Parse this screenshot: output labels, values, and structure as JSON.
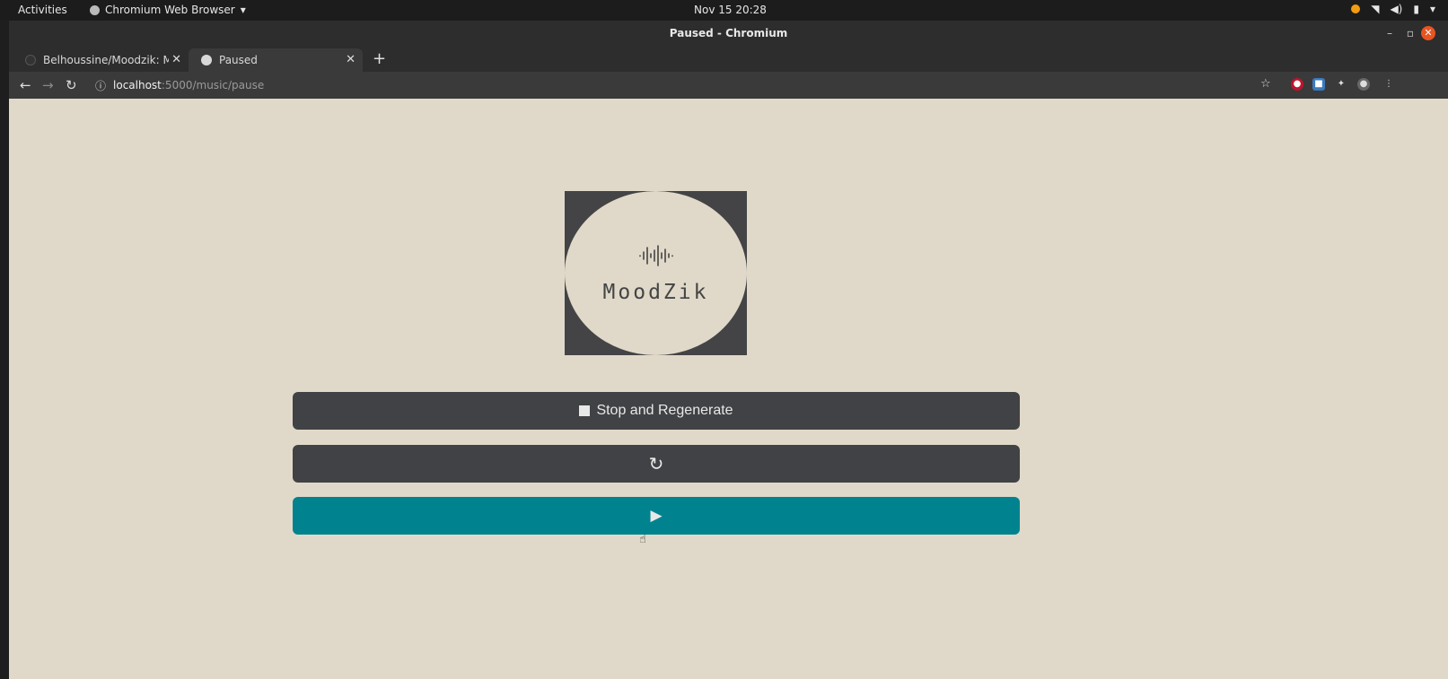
{
  "system_bar": {
    "activities": "Activities",
    "app_menu": "Chromium Web Browser",
    "clock": "Nov 15  20:28"
  },
  "window": {
    "title": "Paused - Chromium",
    "controls": {
      "minimize": "–",
      "maximize": "▫",
      "close": "✕"
    }
  },
  "tabs": [
    {
      "label": "Belhoussine/Moodzik: M",
      "active": false
    },
    {
      "label": "Paused",
      "active": true
    }
  ],
  "new_tab": "+",
  "address_bar": {
    "host": "localhost",
    "path": ":5000/music/pause"
  },
  "page": {
    "logo_text": "MoodZik",
    "stop_label": "Stop and Regenerate",
    "regenerate_icon": "↻",
    "play_icon": "▶"
  },
  "colors": {
    "page_bg": "#e0d9c9",
    "button_dark": "#414245",
    "button_play": "#00838f",
    "logo_square": "#444446"
  }
}
